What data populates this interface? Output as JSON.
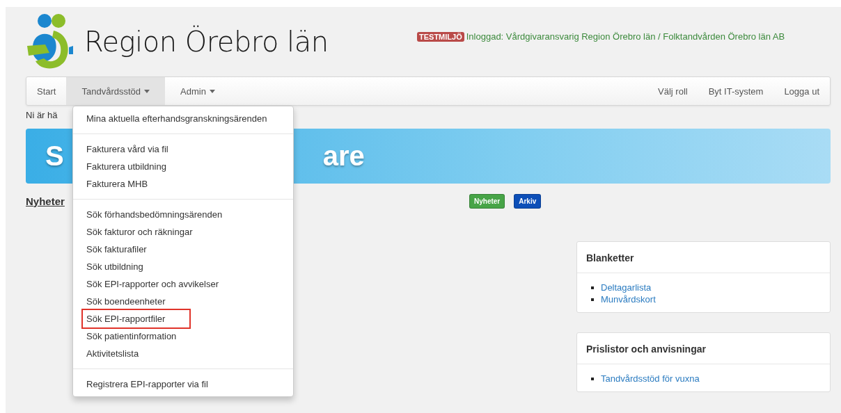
{
  "header": {
    "title": "Region Örebro län",
    "env_badge": "TESTMILJÖ",
    "login_info": "Inloggad: Vårdgivaransvarig Region Örebro län / Folktandvården Örebro län AB"
  },
  "nav": {
    "left": [
      {
        "label": "Start",
        "selected": false,
        "caret": false
      },
      {
        "label": "Tandvårdsstöd",
        "selected": true,
        "caret": true
      },
      {
        "label": "Admin",
        "selected": false,
        "caret": true
      }
    ],
    "right": [
      "Välj roll",
      "Byt IT-system",
      "Logga ut"
    ]
  },
  "dropdown": {
    "groups": [
      [
        {
          "label": "Mina aktuella efterhandsgranskningsärenden",
          "marked": false
        }
      ],
      [
        {
          "label": "Fakturera vård via fil",
          "marked": false
        },
        {
          "label": "Fakturera utbildning",
          "marked": false
        },
        {
          "label": "Fakturera MHB",
          "marked": false
        }
      ],
      [
        {
          "label": "Sök förhandsbedömningsärenden",
          "marked": false
        },
        {
          "label": "Sök fakturor och räkningar",
          "marked": false
        },
        {
          "label": "Sök fakturafiler",
          "marked": false
        },
        {
          "label": "Sök utbildning",
          "marked": false
        },
        {
          "label": "Sök EPI-rapporter och avvikelser",
          "marked": false
        },
        {
          "label": "Sök boendeenheter",
          "marked": false
        },
        {
          "label": "Sök EPI-rapportfiler",
          "marked": true
        },
        {
          "label": "Sök patientinformation",
          "marked": false
        },
        {
          "label": "Aktivitetslista",
          "marked": false
        }
      ],
      [
        {
          "label": "Registrera EPI-rapporter via fil",
          "marked": false
        }
      ]
    ]
  },
  "breadcrumb": "Ni är hä",
  "banner": {
    "left_text": "S",
    "right_text": "are"
  },
  "news": {
    "heading": "Nyheter",
    "buttons": [
      {
        "label": "Nyheter",
        "color": "#47a447"
      },
      {
        "label": "Arkiv",
        "color": "#0d4fb8"
      }
    ]
  },
  "cards": [
    {
      "title": "Blanketter",
      "links": [
        "Deltagarlista",
        "Munvårdskort"
      ]
    },
    {
      "title": "Prislistor och anvisningar",
      "links": [
        "Tandvårdsstöd för vuxna"
      ]
    }
  ]
}
